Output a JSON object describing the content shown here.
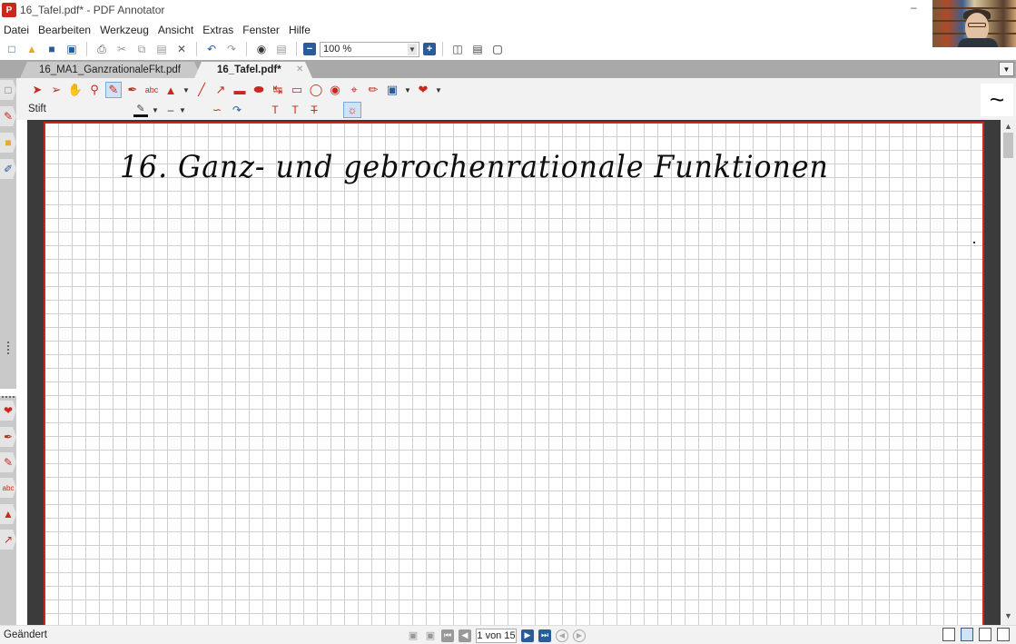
{
  "window": {
    "title": "16_Tafel.pdf* - PDF Annotator",
    "app_icon": "pdf-annotator-icon",
    "minimize_symbol": "–"
  },
  "menu": [
    "Datei",
    "Bearbeiten",
    "Werkzeug",
    "Ansicht",
    "Extras",
    "Fenster",
    "Hilfe"
  ],
  "toolbar": {
    "zoom_value": "100 %",
    "icons": [
      "new-document-icon",
      "open-folder-icon",
      "save-icon",
      "save-as-icon",
      "print-icon",
      "cut-icon",
      "copy-icon",
      "paste-icon",
      "delete-icon",
      "undo-icon",
      "redo-icon",
      "binoculars-icon",
      "page-layout-icon",
      "zoom-out-icon",
      "zoom-in-icon",
      "fit-width-icon",
      "fit-page-icon",
      "fullscreen-icon"
    ]
  },
  "tabs": [
    {
      "label": "16_MA1_GanzrationaleFkt.pdf",
      "active": false
    },
    {
      "label": "16_Tafel.pdf*",
      "active": true
    }
  ],
  "annotation_toolbar": {
    "tool_name": "Stift",
    "tools": [
      "select-arrow-icon",
      "select-text-icon",
      "hand-icon",
      "zoom-tool-icon",
      "pen-icon",
      "highlighter-icon",
      "text-box-icon",
      "stamp-icon",
      "line-icon",
      "arrow-icon",
      "rectangle-icon",
      "ellipse-icon",
      "measure-icon",
      "eraser-icon",
      "lasso-icon",
      "camera-icon",
      "crop-icon",
      "pencil-icon",
      "image-icon",
      "favorites-heart-icon"
    ],
    "active_tool": "pen-icon",
    "pen_color": "#111111",
    "right_symbol": "~"
  },
  "document": {
    "handwritten_title": "16. Ganz- und gebrochenrationale Funktionen",
    "page_style": "grid paper",
    "border_color": "#c8281e"
  },
  "status": {
    "text": "Geändert",
    "page_indicator": "1 von 15"
  },
  "colors": {
    "accent_red": "#c8281e",
    "accent_blue": "#2a5c9a",
    "tab_bar": "#a9a9a9",
    "viewer_bg": "#3b3b3b"
  }
}
